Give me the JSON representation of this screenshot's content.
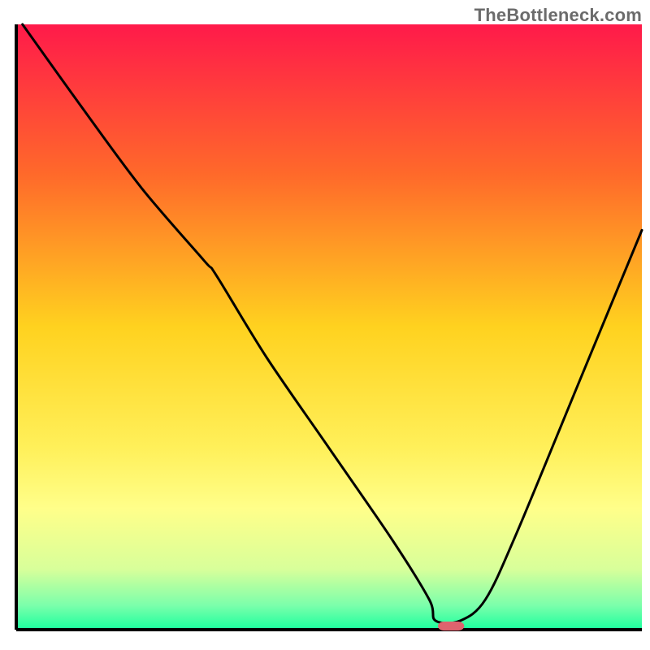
{
  "watermark": "TheBottleneck.com",
  "chart_data": {
    "type": "line",
    "title": "",
    "xlabel": "",
    "ylabel": "",
    "xlim": [
      0,
      100
    ],
    "ylim": [
      0,
      100
    ],
    "gradient_stops": [
      {
        "offset": 0.0,
        "color": "#ff1a4a"
      },
      {
        "offset": 0.25,
        "color": "#ff6a2a"
      },
      {
        "offset": 0.5,
        "color": "#ffd21f"
      },
      {
        "offset": 0.7,
        "color": "#fff05a"
      },
      {
        "offset": 0.8,
        "color": "#ffff8a"
      },
      {
        "offset": 0.9,
        "color": "#d8ff9a"
      },
      {
        "offset": 0.96,
        "color": "#7bffab"
      },
      {
        "offset": 1.0,
        "color": "#1aff9e"
      }
    ],
    "series": [
      {
        "name": "bottleneck-curve",
        "stroke": "#000000",
        "x": [
          1,
          10,
          20,
          30,
          32,
          40,
          50,
          60,
          66,
          67,
          71,
          75,
          80,
          90,
          100
        ],
        "y": [
          100,
          87,
          73,
          61,
          58.5,
          45,
          30,
          15,
          5,
          1.5,
          1.5,
          5,
          16,
          41,
          66
        ]
      }
    ],
    "marker": {
      "name": "optimal-marker",
      "shape": "rounded-rect",
      "color": "#e0636e",
      "x": 69.5,
      "y": 0.6,
      "width": 4.2,
      "height": 1.5,
      "rx": 1.0
    },
    "axes": {
      "stroke": "#000000",
      "stroke_width": 4,
      "xaxis_y": 0,
      "yaxis_x": 0
    }
  }
}
